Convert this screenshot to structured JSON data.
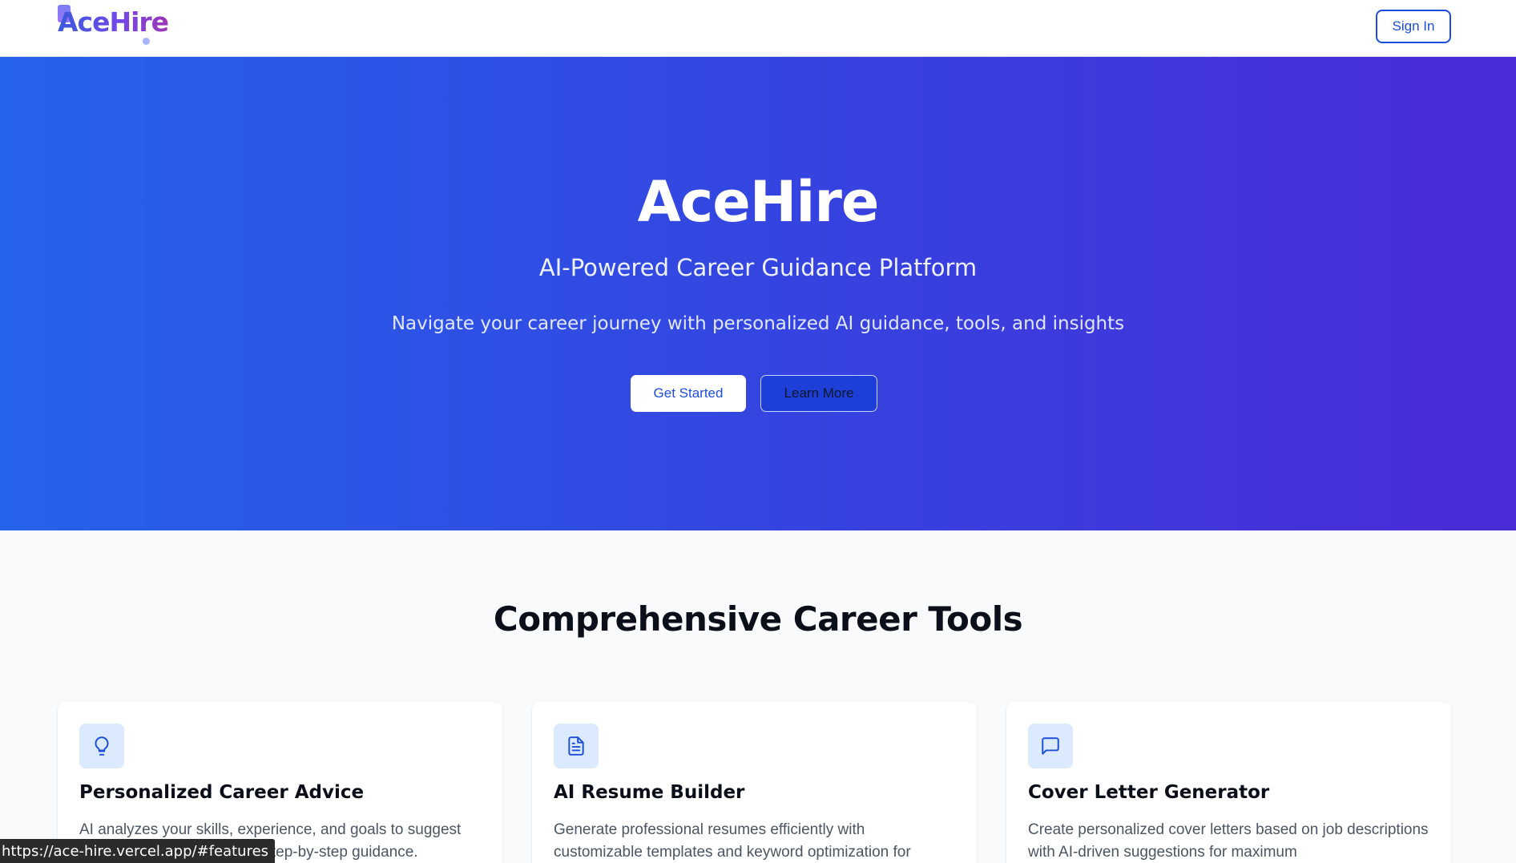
{
  "header": {
    "logo_text": "AceHire",
    "signin_label": "Sign In"
  },
  "hero": {
    "title": "AceHire",
    "subtitle": "AI-Powered Career Guidance Platform",
    "tagline": "Navigate your career journey with personalized AI guidance, tools, and insights",
    "primary_button": "Get Started",
    "secondary_button": "Learn More"
  },
  "features": {
    "title": "Comprehensive Career Tools",
    "cards": [
      {
        "icon": "lightbulb-icon",
        "title": "Personalized Career Advice",
        "desc_visible": "AI analyzes your skills, experience, and goals to suggest",
        "desc_visible_2": "ith step-by-step guidance."
      },
      {
        "icon": "document-icon",
        "title": "AI Resume Builder",
        "desc": "Generate professional resumes efficiently with customizable templates and keyword optimization for"
      },
      {
        "icon": "chat-bubble-icon",
        "title": "Cover Letter Generator",
        "desc": "Create personalized cover letters based on job descriptions with AI-driven suggestions for maximum"
      }
    ]
  },
  "status_bar": {
    "url": "https://ace-hire.vercel.app/#features"
  },
  "colors": {
    "accent": "#1d4ed8",
    "hero_start": "#2563eb",
    "hero_end": "#4a2bd6",
    "icon_bg": "#dbeafe"
  }
}
